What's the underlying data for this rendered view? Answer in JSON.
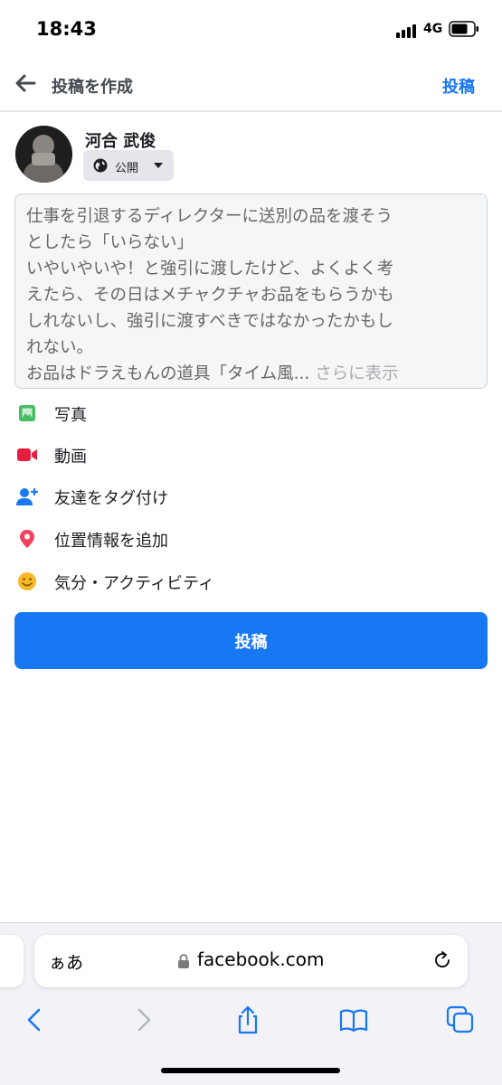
{
  "status_bar": {
    "time": "18:43",
    "network": "4G"
  },
  "header": {
    "title": "投稿を作成",
    "post_label": "投稿"
  },
  "user": {
    "name": "河合 武俊",
    "privacy": "公開"
  },
  "post_text": {
    "lines": [
      "仕事を引退するディレクターに送別の品を渡そう",
      "としたら「いらない」",
      "いやいやいや！と強引に渡したけど、よくよく考",
      "えたら、その日はメチャクチャお品をもらうかも",
      "しれないし、強引に渡すべきではなかったかもし",
      "れない。",
      "お品はドラえもんの道具「タイム風..."
    ],
    "see_more": "さらに表示"
  },
  "options": [
    {
      "label": "写真",
      "icon": "photo-icon",
      "color": "#45bd62"
    },
    {
      "label": "動画",
      "icon": "video-icon",
      "color": "#e41e3f"
    },
    {
      "label": "友達をタグ付け",
      "icon": "tag-friends-icon",
      "color": "#1877f2"
    },
    {
      "label": "位置情報を追加",
      "icon": "location-pin-icon",
      "color": "#f3425f"
    },
    {
      "label": "気分・アクティビティ",
      "icon": "smiley-icon",
      "color": "#f7b928"
    }
  ],
  "post_button": {
    "label": "投稿"
  },
  "browser": {
    "aa_label": "ぁあ",
    "url": "facebook.com"
  },
  "colors": {
    "accent": "#1877f2",
    "background": "#ffffff"
  }
}
